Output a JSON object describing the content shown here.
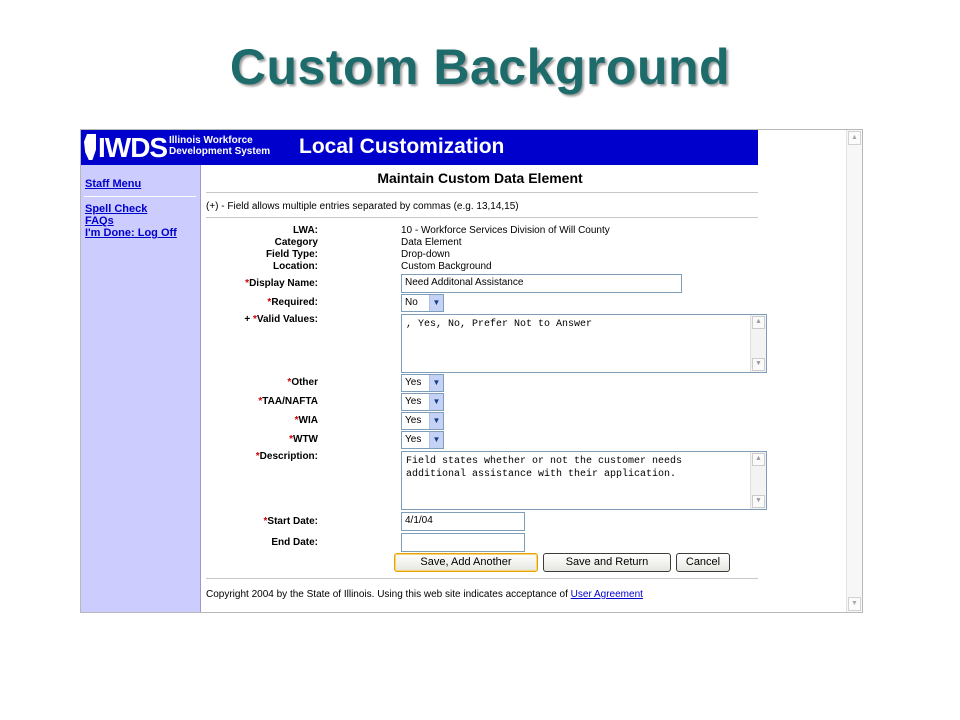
{
  "slide": {
    "title": "Custom Background"
  },
  "banner": {
    "logo_text": "IWDS",
    "logo_subtitle": "Illinois Workforce Development System",
    "title": "Local Customization",
    "color": "#0000cc"
  },
  "sidebar": {
    "items": [
      {
        "label": "Staff Menu"
      },
      {
        "label": "Spell Check"
      },
      {
        "label": "FAQs"
      },
      {
        "label": "I'm Done: Log Off"
      }
    ],
    "color": "#ccccff"
  },
  "main": {
    "heading": "Maintain Custom Data Element",
    "note": "(+) - Field allows multiple entries separated by commas (e.g. 13,14,15)",
    "info": {
      "lwa_label": "LWA:",
      "lwa_value": "10 - Workforce Services Division of Will County",
      "category_label": "Category",
      "category_value": "Data Element",
      "field_type_label": "Field Type:",
      "field_type_value": "Drop-down",
      "location_label": "Location:",
      "location_value": "Custom Background"
    },
    "form": {
      "required_marker": "*",
      "plus_marker": "+ ",
      "display_name_label": "Display Name:",
      "display_name_value": "Need Additonal Assistance",
      "required_label": "Required:",
      "required_value": "No",
      "valid_values_label": "Valid Values:",
      "valid_values_value": ", Yes, No, Prefer Not to Answer",
      "other_label": "Other",
      "other_value": "Yes",
      "taa_label": "TAA/NAFTA",
      "taa_value": "Yes",
      "wia_label": "WIA",
      "wia_value": "Yes",
      "wtw_label": "WTW",
      "wtw_value": "Yes",
      "description_label": "Description:",
      "description_value": "Field states whether or not the customer needs additional assistance with their application.",
      "start_date_label": "Start Date:",
      "start_date_value": "4/1/04",
      "end_date_label": "End Date:",
      "end_date_value": ""
    },
    "buttons": {
      "save_add_another": "Save, Add Another",
      "save_and_return": "Save and Return",
      "cancel": "Cancel"
    },
    "footer": {
      "text": "Copyright 2004 by the State of Illinois. Using this web site indicates acceptance of ",
      "link": "User Agreement"
    }
  },
  "icons": {
    "scroll_up": "scroll-up-arrow-icon",
    "scroll_down": "scroll-down-arrow-icon",
    "dropdown": "chevron-down-icon"
  }
}
